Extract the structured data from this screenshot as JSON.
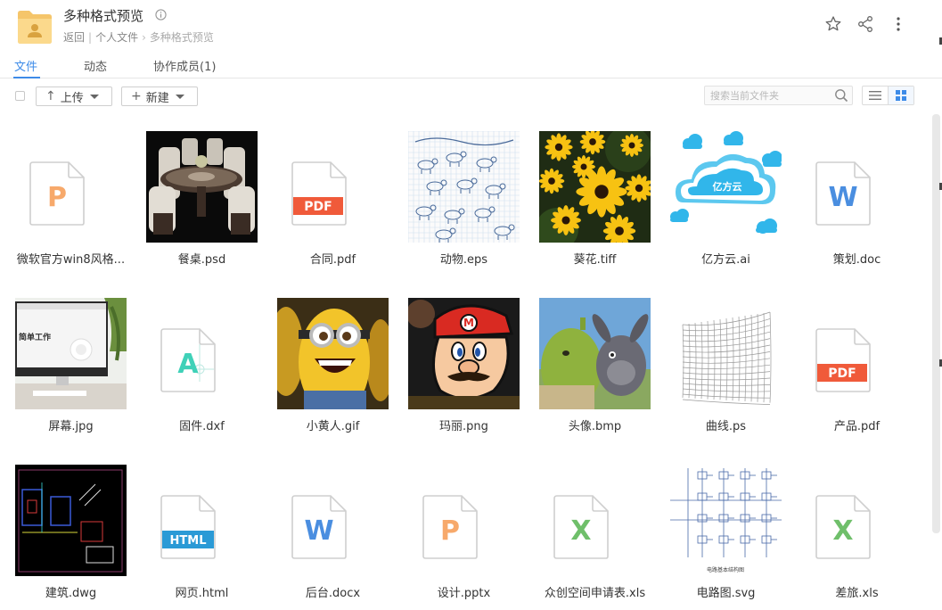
{
  "header": {
    "title": "多种格式预览",
    "breadcrumb": {
      "back": "返回",
      "root": "个人文件",
      "current": "多种格式预览"
    }
  },
  "tabs": [
    {
      "label": "文件"
    },
    {
      "label": "动态"
    },
    {
      "label": "协作成员(1)"
    }
  ],
  "toolbar": {
    "upload_label": "上传",
    "new_label": "新建",
    "search_placeholder": "搜索当前文件夹"
  },
  "files": [
    {
      "name": "微软官方win8风格...",
      "type": "pptx",
      "badge": "P"
    },
    {
      "name": "餐桌.psd",
      "type": "image",
      "preview": "dining-table"
    },
    {
      "name": "合同.pdf",
      "type": "pdf",
      "badge": "PDF"
    },
    {
      "name": "动物.eps",
      "type": "image",
      "preview": "animal-sketch"
    },
    {
      "name": "葵花.tiff",
      "type": "image",
      "preview": "sunflowers"
    },
    {
      "name": "亿方云.ai",
      "type": "image",
      "preview": "cloud-logo",
      "logo_text": "亿方云"
    },
    {
      "name": "策划.doc",
      "type": "word",
      "badge": "W"
    },
    {
      "name": "屏幕.jpg",
      "type": "image",
      "preview": "monitor",
      "screen_text": "简单工作"
    },
    {
      "name": "固件.dxf",
      "type": "dxf",
      "badge": "A"
    },
    {
      "name": "小黄人.gif",
      "type": "image",
      "preview": "minion"
    },
    {
      "name": "玛丽.png",
      "type": "image",
      "preview": "mario"
    },
    {
      "name": "头像.bmp",
      "type": "image",
      "preview": "shrek"
    },
    {
      "name": "曲线.ps",
      "type": "image",
      "preview": "mesh-curve"
    },
    {
      "name": "产品.pdf",
      "type": "pdf",
      "badge": "PDF"
    },
    {
      "name": "建筑.dwg",
      "type": "image",
      "preview": "cad-drawing"
    },
    {
      "name": "网页.html",
      "type": "html",
      "badge": "HTML"
    },
    {
      "name": "后台.docx",
      "type": "word",
      "badge": "W"
    },
    {
      "name": "设计.pptx",
      "type": "pptx",
      "badge": "P"
    },
    {
      "name": "众创空间申请表.xls",
      "type": "excel",
      "badge": "X"
    },
    {
      "name": "电路图.svg",
      "type": "image",
      "preview": "circuit",
      "caption": "电路基本结构图"
    },
    {
      "name": "差旅.xls",
      "type": "excel",
      "badge": "X"
    }
  ],
  "colors": {
    "accent": "#3d8be8",
    "pdf": "#f05a3a",
    "word": "#4a8ee0",
    "excel": "#6fbf6a",
    "ppt": "#f7a96b",
    "dxf": "#3fd1b8",
    "html": "#2a9ad6"
  }
}
